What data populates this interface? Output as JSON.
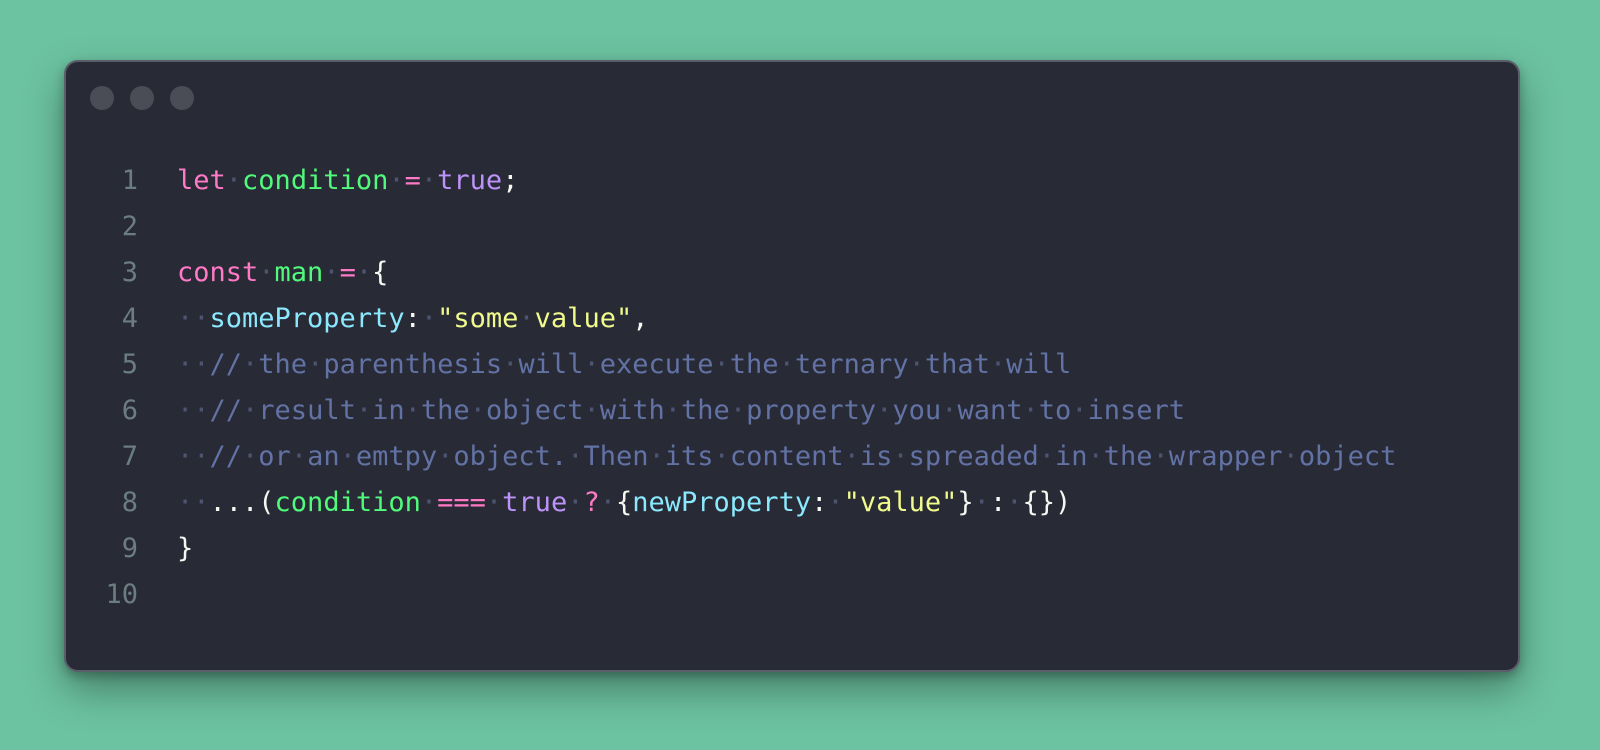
{
  "window": {
    "controls": [
      "close",
      "minimize",
      "maximize"
    ]
  },
  "code": {
    "lines": [
      {
        "number": "1",
        "tokens": [
          {
            "text": "let",
            "type": "kw"
          },
          {
            "text": "·",
            "type": "ws"
          },
          {
            "text": "condition",
            "type": "var"
          },
          {
            "text": "·",
            "type": "ws"
          },
          {
            "text": "=",
            "type": "op"
          },
          {
            "text": "·",
            "type": "ws"
          },
          {
            "text": "true",
            "type": "bool"
          },
          {
            "text": ";",
            "type": "punct"
          }
        ]
      },
      {
        "number": "2",
        "tokens": []
      },
      {
        "number": "3",
        "tokens": [
          {
            "text": "const",
            "type": "kw"
          },
          {
            "text": "·",
            "type": "ws"
          },
          {
            "text": "man",
            "type": "var"
          },
          {
            "text": "·",
            "type": "ws"
          },
          {
            "text": "=",
            "type": "op"
          },
          {
            "text": "·",
            "type": "ws"
          },
          {
            "text": "{",
            "type": "punct"
          }
        ]
      },
      {
        "number": "4",
        "tokens": [
          {
            "text": "··",
            "type": "ws"
          },
          {
            "text": "someProperty",
            "type": "prop"
          },
          {
            "text": ":",
            "type": "punct"
          },
          {
            "text": "·",
            "type": "ws"
          },
          {
            "text": "\"some",
            "type": "str"
          },
          {
            "text": "·",
            "type": "ws"
          },
          {
            "text": "value\"",
            "type": "str"
          },
          {
            "text": ",",
            "type": "punct"
          }
        ]
      },
      {
        "number": "5",
        "tokens": [
          {
            "text": "··",
            "type": "ws"
          },
          {
            "text": "//",
            "type": "cmt"
          },
          {
            "text": "·",
            "type": "ws"
          },
          {
            "text": "the",
            "type": "cmt"
          },
          {
            "text": "·",
            "type": "ws"
          },
          {
            "text": "parenthesis",
            "type": "cmt"
          },
          {
            "text": "·",
            "type": "ws"
          },
          {
            "text": "will",
            "type": "cmt"
          },
          {
            "text": "·",
            "type": "ws"
          },
          {
            "text": "execute",
            "type": "cmt"
          },
          {
            "text": "·",
            "type": "ws"
          },
          {
            "text": "the",
            "type": "cmt"
          },
          {
            "text": "·",
            "type": "ws"
          },
          {
            "text": "ternary",
            "type": "cmt"
          },
          {
            "text": "·",
            "type": "ws"
          },
          {
            "text": "that",
            "type": "cmt"
          },
          {
            "text": "·",
            "type": "ws"
          },
          {
            "text": "will",
            "type": "cmt"
          }
        ]
      },
      {
        "number": "6",
        "tokens": [
          {
            "text": "··",
            "type": "ws"
          },
          {
            "text": "//",
            "type": "cmt"
          },
          {
            "text": "·",
            "type": "ws"
          },
          {
            "text": "result",
            "type": "cmt"
          },
          {
            "text": "·",
            "type": "ws"
          },
          {
            "text": "in",
            "type": "cmt"
          },
          {
            "text": "·",
            "type": "ws"
          },
          {
            "text": "the",
            "type": "cmt"
          },
          {
            "text": "·",
            "type": "ws"
          },
          {
            "text": "object",
            "type": "cmt"
          },
          {
            "text": "·",
            "type": "ws"
          },
          {
            "text": "with",
            "type": "cmt"
          },
          {
            "text": "·",
            "type": "ws"
          },
          {
            "text": "the",
            "type": "cmt"
          },
          {
            "text": "·",
            "type": "ws"
          },
          {
            "text": "property",
            "type": "cmt"
          },
          {
            "text": "·",
            "type": "ws"
          },
          {
            "text": "you",
            "type": "cmt"
          },
          {
            "text": "·",
            "type": "ws"
          },
          {
            "text": "want",
            "type": "cmt"
          },
          {
            "text": "·",
            "type": "ws"
          },
          {
            "text": "to",
            "type": "cmt"
          },
          {
            "text": "·",
            "type": "ws"
          },
          {
            "text": "insert",
            "type": "cmt"
          }
        ]
      },
      {
        "number": "7",
        "tokens": [
          {
            "text": "··",
            "type": "ws"
          },
          {
            "text": "//",
            "type": "cmt"
          },
          {
            "text": "·",
            "type": "ws"
          },
          {
            "text": "or",
            "type": "cmt"
          },
          {
            "text": "·",
            "type": "ws"
          },
          {
            "text": "an",
            "type": "cmt"
          },
          {
            "text": "·",
            "type": "ws"
          },
          {
            "text": "emtpy",
            "type": "cmt"
          },
          {
            "text": "·",
            "type": "ws"
          },
          {
            "text": "object.",
            "type": "cmt"
          },
          {
            "text": "·",
            "type": "ws"
          },
          {
            "text": "Then",
            "type": "cmt"
          },
          {
            "text": "·",
            "type": "ws"
          },
          {
            "text": "its",
            "type": "cmt"
          },
          {
            "text": "·",
            "type": "ws"
          },
          {
            "text": "content",
            "type": "cmt"
          },
          {
            "text": "·",
            "type": "ws"
          },
          {
            "text": "is",
            "type": "cmt"
          },
          {
            "text": "·",
            "type": "ws"
          },
          {
            "text": "spreaded",
            "type": "cmt"
          },
          {
            "text": "·",
            "type": "ws"
          },
          {
            "text": "in",
            "type": "cmt"
          },
          {
            "text": "·",
            "type": "ws"
          },
          {
            "text": "the",
            "type": "cmt"
          },
          {
            "text": "·",
            "type": "ws"
          },
          {
            "text": "wrapper",
            "type": "cmt"
          },
          {
            "text": "·",
            "type": "ws"
          },
          {
            "text": "object",
            "type": "cmt"
          }
        ]
      },
      {
        "number": "8",
        "tokens": [
          {
            "text": "··",
            "type": "ws"
          },
          {
            "text": "...(",
            "type": "punct"
          },
          {
            "text": "condition",
            "type": "var"
          },
          {
            "text": "·",
            "type": "ws"
          },
          {
            "text": "===",
            "type": "op"
          },
          {
            "text": "·",
            "type": "ws"
          },
          {
            "text": "true",
            "type": "bool"
          },
          {
            "text": "·",
            "type": "ws"
          },
          {
            "text": "?",
            "type": "op"
          },
          {
            "text": "·",
            "type": "ws"
          },
          {
            "text": "{",
            "type": "punct"
          },
          {
            "text": "newProperty",
            "type": "prop"
          },
          {
            "text": ":",
            "type": "punct"
          },
          {
            "text": "·",
            "type": "ws"
          },
          {
            "text": "\"value\"",
            "type": "str"
          },
          {
            "text": "}",
            "type": "punct"
          },
          {
            "text": "·",
            "type": "ws"
          },
          {
            "text": ":",
            "type": "punct"
          },
          {
            "text": "·",
            "type": "ws"
          },
          {
            "text": "{})",
            "type": "punct"
          }
        ]
      },
      {
        "number": "9",
        "tokens": [
          {
            "text": "}",
            "type": "punct"
          }
        ]
      },
      {
        "number": "10",
        "tokens": []
      }
    ]
  }
}
